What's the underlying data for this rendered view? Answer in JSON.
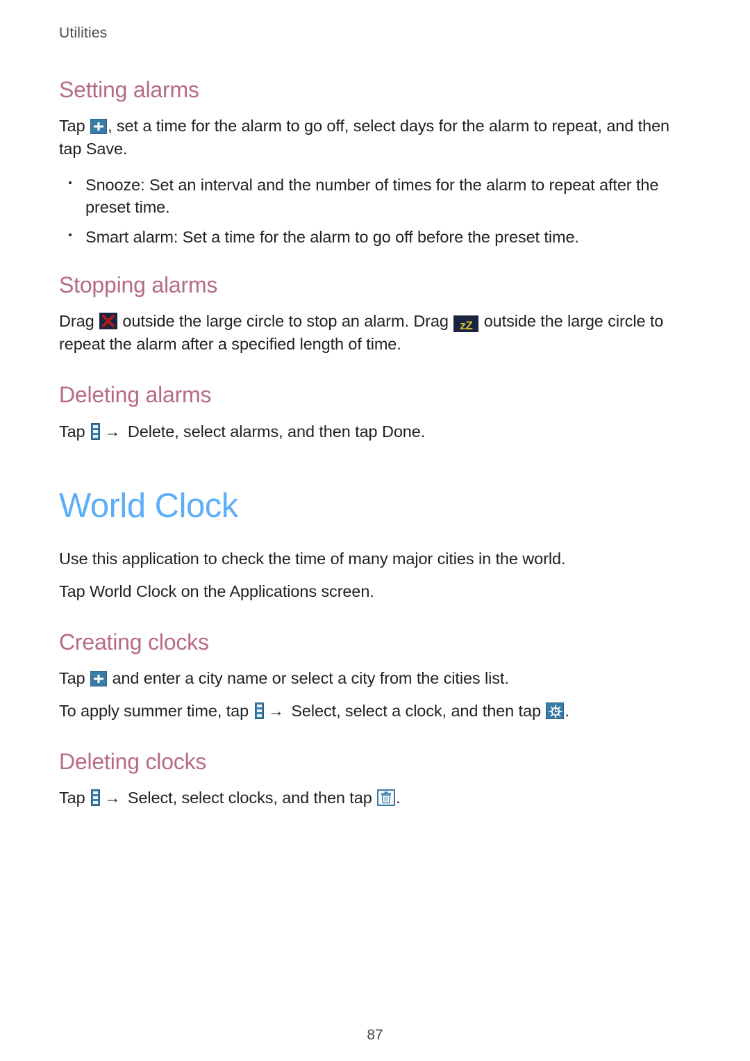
{
  "page": {
    "running_head": "Utilities",
    "folio": "87"
  },
  "colors": {
    "section_heading": "#b76a87",
    "chapter_heading": "#5cadfa",
    "body_text": "#231f20",
    "icon_blue": "#3a7ca8",
    "icon_navy": "#1b2440",
    "icon_yellow": "#d7c029",
    "icon_red": "#b01c1c"
  },
  "sections": [
    {
      "heading": "Setting alarms",
      "paragraph": {
        "before_icon": "Tap ",
        "icon": "plus-icon",
        "after_icon": ", set a time for the alarm to go off, select days for the alarm to repeat, and then tap Save."
      },
      "bullets": [
        "Snooze: Set an interval and the number of times for the alarm to repeat after the preset time.",
        "Smart alarm: Set a time for the alarm to go off before the preset time."
      ]
    },
    {
      "heading": "Stopping alarms",
      "paragraph": {
        "part1": "Drag ",
        "icon1": "dismiss-x-icon",
        "part2": " outside the large circle to stop an alarm. Drag ",
        "icon2": "snooze-zz-icon",
        "part3": " outside the large circle to repeat the alarm after a specified length of time."
      }
    },
    {
      "heading": "Deleting alarms",
      "paragraph": {
        "part1": "Tap ",
        "icon1": "menu-icon",
        "arrow": "→",
        "part2": " Delete, select alarms, and then tap Done."
      }
    }
  ],
  "chapter": {
    "title": "World Clock",
    "intro_1": "Use this application to check the time of many major cities in the world.",
    "intro_2": "Tap World Clock on the Applications screen."
  },
  "clock_sections": [
    {
      "heading": "Creating clocks",
      "line_1": {
        "part1": "Tap ",
        "icon1": "plus-icon",
        "part2": " and enter a city name or select a city from the cities list."
      },
      "line_2": {
        "part1": "To apply summer time, tap ",
        "icon1": "menu-icon",
        "arrow": "→",
        "part2": " Select, select a clock, and then tap ",
        "icon2": "summer-time-sun-icon",
        "part3": "."
      }
    },
    {
      "heading": "Deleting clocks",
      "line_1": {
        "part1": "Tap ",
        "icon1": "menu-icon",
        "arrow": "→",
        "part2": " Select, select clocks, and then tap ",
        "icon2": "trash-icon",
        "part3": "."
      }
    }
  ]
}
